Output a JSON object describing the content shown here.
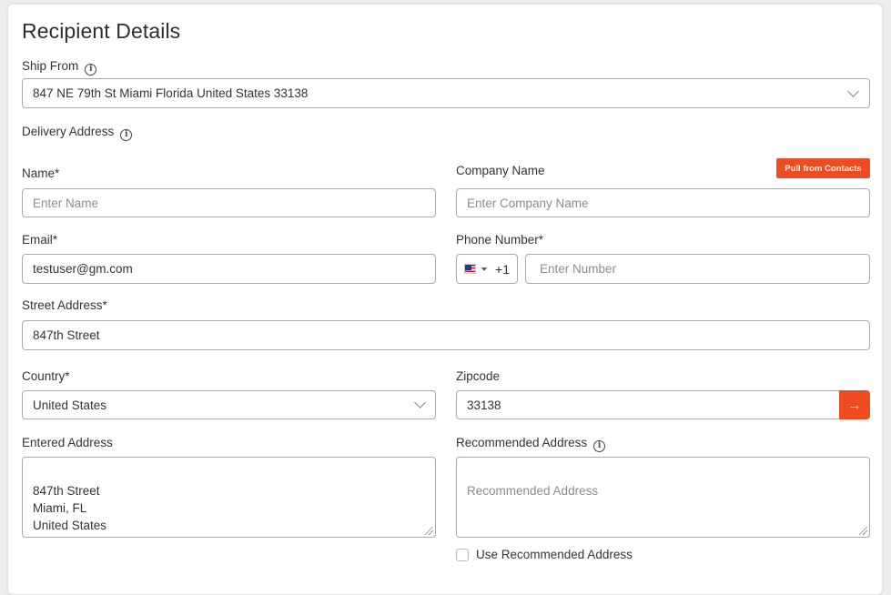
{
  "section": {
    "title": "Recipient Details"
  },
  "ship_from": {
    "label": "Ship From",
    "value": "847 NE 79th St Miami Florida United States 33138"
  },
  "delivery": {
    "label": "Delivery Address",
    "pull_button": "Pull from Contacts"
  },
  "fields": {
    "name": {
      "label": "Name*",
      "placeholder": "Enter Name",
      "value": ""
    },
    "company": {
      "label": "Company Name",
      "placeholder": "Enter Company Name",
      "value": ""
    },
    "email": {
      "label": "Email*",
      "value": "testuser@gm.com"
    },
    "phone": {
      "label": "Phone Number*",
      "country_code": "+1",
      "placeholder": "Enter Number",
      "value": ""
    },
    "street": {
      "label": "Street Address*",
      "value": "847th Street"
    },
    "country": {
      "label": "Country*",
      "value": "United States"
    },
    "zipcode": {
      "label": "Zipcode",
      "value": "33138"
    },
    "entered_address": {
      "label": "Entered Address",
      "value": "847th Street\nMiami, FL\nUnited States"
    },
    "recommended_address": {
      "label": "Recommended Address",
      "placeholder": "Recommended Address",
      "value": ""
    },
    "use_recommended": {
      "label": "Use Recommended Address",
      "checked": false
    }
  },
  "icons": {
    "info": "ⓘ",
    "arrow": "→"
  },
  "colors": {
    "accent": "#ee4b22",
    "border": "#a9a9a9",
    "text": "#333333",
    "placeholder": "#8c8c8c"
  }
}
